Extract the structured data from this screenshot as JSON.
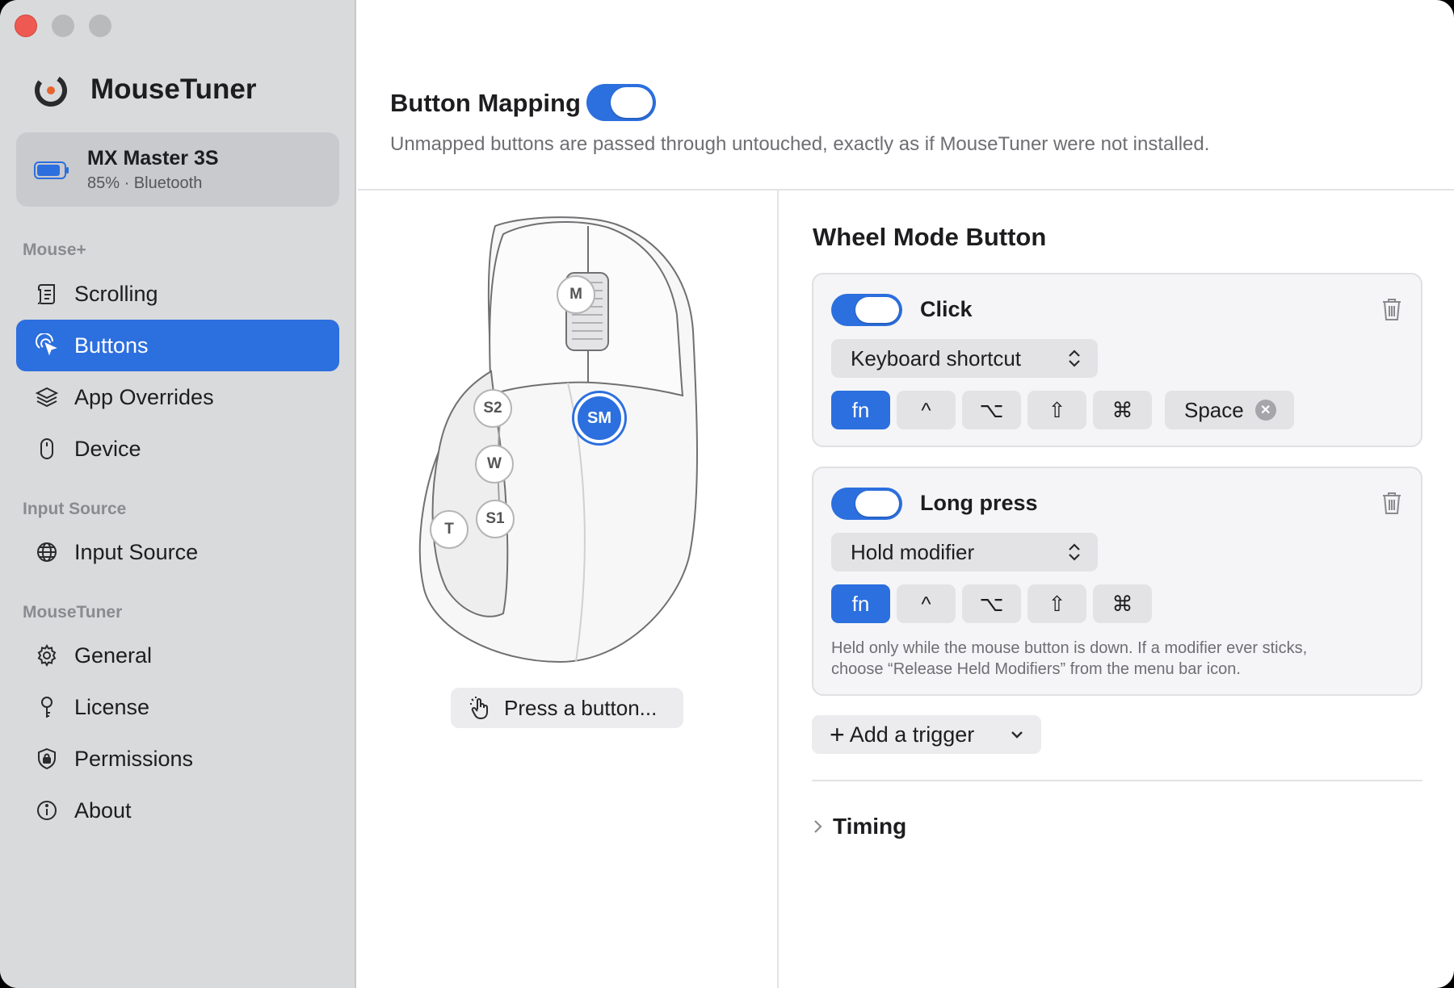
{
  "app": {
    "name": "MouseTuner"
  },
  "device": {
    "name": "MX Master 3S",
    "status": "85% · Bluetooth",
    "battery_percent": 85
  },
  "sidebar": {
    "sections": [
      {
        "label": "Mouse+"
      },
      {
        "label": "Input Source"
      },
      {
        "label": "MouseTuner"
      }
    ],
    "items": [
      {
        "label": "Scrolling",
        "icon": "scroll-icon"
      },
      {
        "label": "Buttons",
        "icon": "pointer-click-icon",
        "active": true
      },
      {
        "label": "App Overrides",
        "icon": "layers-icon"
      },
      {
        "label": "Device",
        "icon": "mouse-icon"
      },
      {
        "label": "Input Source",
        "icon": "globe-icon"
      },
      {
        "label": "General",
        "icon": "gear-icon"
      },
      {
        "label": "License",
        "icon": "key-icon"
      },
      {
        "label": "Permissions",
        "icon": "shield-lock-icon"
      },
      {
        "label": "About",
        "icon": "info-icon"
      }
    ]
  },
  "header": {
    "title": "Button Mapping",
    "enabled": true,
    "subtitle": "Unmapped buttons are passed through untouched, exactly as if MouseTuner were not installed."
  },
  "mouse": {
    "buttons": [
      "M",
      "S2",
      "SM",
      "W",
      "S1",
      "T"
    ],
    "selected": "SM",
    "press_label": "Press a button..."
  },
  "panel": {
    "title": "Wheel Mode Button",
    "triggers": [
      {
        "title": "Click",
        "enabled": true,
        "action": "Keyboard shortcut",
        "modifiers": [
          "fn",
          "^",
          "⌥",
          "⇧",
          "⌘"
        ],
        "active_modifiers": [
          "fn"
        ],
        "key": "Space"
      },
      {
        "title": "Long press",
        "enabled": true,
        "action": "Hold modifier",
        "modifiers": [
          "fn",
          "^",
          "⌥",
          "⇧",
          "⌘"
        ],
        "active_modifiers": [
          "fn"
        ],
        "note_line1": "Held only while the mouse button is down. If a modifier ever sticks,",
        "note_line2": "choose “Release Held Modifiers” from the menu bar icon."
      }
    ],
    "add_trigger": "Add a trigger",
    "timing": "Timing"
  },
  "colors": {
    "accent": "#2c6fde",
    "sidebar": "#d9dadc",
    "close": "#ee5a52"
  }
}
